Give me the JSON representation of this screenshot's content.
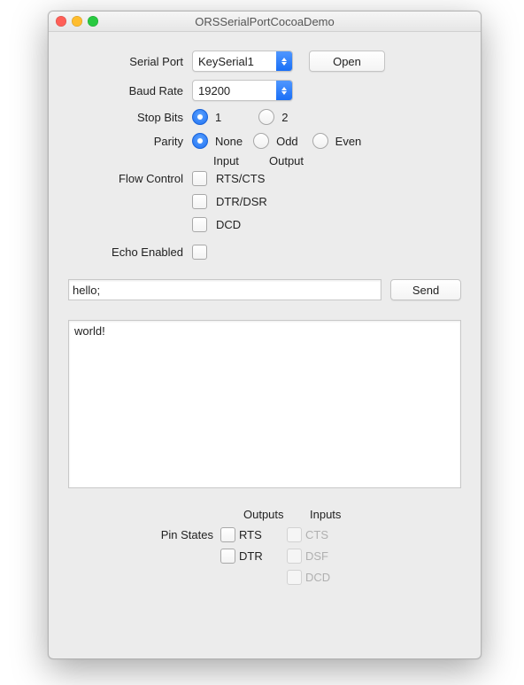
{
  "window": {
    "title": "ORSSerialPortCocoaDemo"
  },
  "form": {
    "serial_port_label": "Serial Port",
    "serial_port_value": "KeySerial1",
    "open_button": "Open",
    "baud_rate_label": "Baud Rate",
    "baud_rate_value": "19200",
    "stop_bits_label": "Stop Bits",
    "stop_bits_options": {
      "one": "1",
      "two": "2"
    },
    "parity_label": "Parity",
    "parity_options": {
      "none": "None",
      "odd": "Odd",
      "even": "Even"
    },
    "flow_header_input": "Input",
    "flow_header_output": "Output",
    "flow_control_label": "Flow Control",
    "flow_rtscts": "RTS/CTS",
    "flow_dtrdsr": "DTR/DSR",
    "flow_dcd": "DCD",
    "echo_label": "Echo Enabled"
  },
  "send": {
    "input_value": "hello;",
    "button": "Send"
  },
  "output": {
    "text": "world!"
  },
  "pins": {
    "header_outputs": "Outputs",
    "header_inputs": "Inputs",
    "label": "Pin States",
    "out_rts": "RTS",
    "out_dtr": "DTR",
    "in_cts": "CTS",
    "in_dsf": "DSF",
    "in_dcd": "DCD"
  }
}
